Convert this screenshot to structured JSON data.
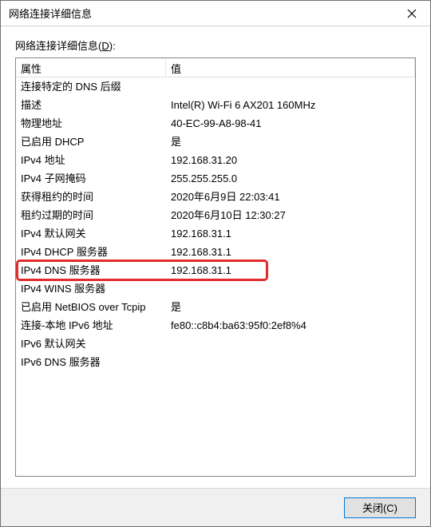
{
  "window": {
    "title": "网络连接详细信息"
  },
  "body": {
    "label_prefix": "网络连接详细信息(",
    "label_underline": "D",
    "label_suffix": "):",
    "columns": {
      "property": "属性",
      "value": "值"
    },
    "rows": [
      {
        "prop": "连接特定的 DNS 后缀",
        "val": ""
      },
      {
        "prop": "描述",
        "val": "Intel(R) Wi-Fi 6 AX201 160MHz"
      },
      {
        "prop": "物理地址",
        "val": "40-EC-99-A8-98-41"
      },
      {
        "prop": "已启用 DHCP",
        "val": "是"
      },
      {
        "prop": "IPv4 地址",
        "val": "192.168.31.20"
      },
      {
        "prop": "IPv4 子网掩码",
        "val": "255.255.255.0"
      },
      {
        "prop": "获得租约的时间",
        "val": "2020年6月9日 22:03:41"
      },
      {
        "prop": "租约过期的时间",
        "val": "2020年6月10日 12:30:27"
      },
      {
        "prop": "IPv4 默认网关",
        "val": "192.168.31.1"
      },
      {
        "prop": "IPv4 DHCP 服务器",
        "val": "192.168.31.1"
      },
      {
        "prop": "IPv4 DNS 服务器",
        "val": "192.168.31.1"
      },
      {
        "prop": "IPv4 WINS 服务器",
        "val": ""
      },
      {
        "prop": "已启用 NetBIOS over Tcpip",
        "val": "是"
      },
      {
        "prop": "连接-本地 IPv6 地址",
        "val": "fe80::c8b4:ba63:95f0:2ef8%4"
      },
      {
        "prop": "IPv6 默认网关",
        "val": ""
      },
      {
        "prop": "IPv6 DNS 服务器",
        "val": ""
      }
    ],
    "highlight_index": 10
  },
  "buttons": {
    "close": "关闭(C)"
  }
}
